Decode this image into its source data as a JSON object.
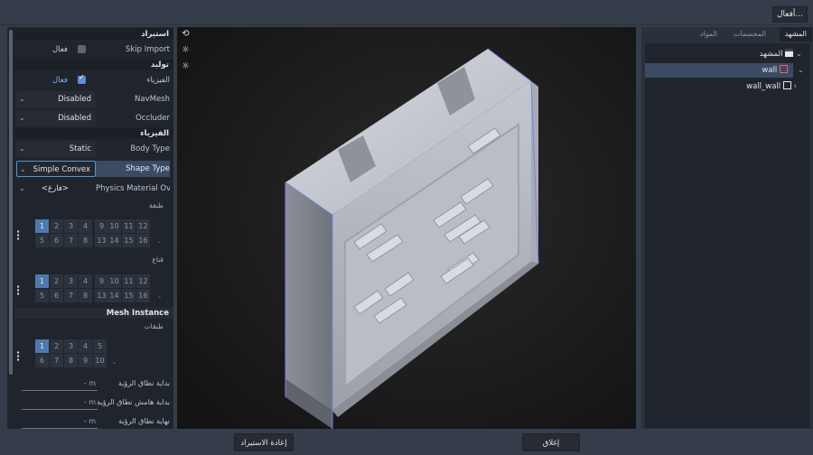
{
  "topbar": {
    "actions_label": "أفعال..."
  },
  "inspector": {
    "import_section": "استيراد",
    "skip_import": {
      "label": "Skip Import",
      "state": "فعال",
      "checked": false
    },
    "generate_section": "توليد",
    "physics_toggle": {
      "label": "الفيزياء",
      "state": "فعال",
      "checked": true
    },
    "navmesh": {
      "label": "NavMesh",
      "value": "Disabled"
    },
    "occluder": {
      "label": "Occluder",
      "value": "Disabled"
    },
    "physics_section": "الفيزياء",
    "body_type": {
      "label": "Body Type",
      "value": "Static"
    },
    "shape_type": {
      "label": "Shape Type",
      "value": "Simple Convex"
    },
    "physics_material": {
      "label": "Physics Material Ov",
      "value": "<فارغ>"
    },
    "layer_label": "طبقة",
    "mask_label": "قناع",
    "layer_cells": [
      "1",
      "2",
      "3",
      "4",
      "9",
      "10",
      "11",
      "12",
      "5",
      "6",
      "7",
      "8",
      "13",
      "14",
      "15",
      "16"
    ],
    "layer_selected": [
      "1"
    ],
    "mask_cells": [
      "1",
      "2",
      "3",
      "4",
      "9",
      "10",
      "11",
      "12",
      "5",
      "6",
      "7",
      "8",
      "13",
      "14",
      "15",
      "16"
    ],
    "mask_selected": [
      "1"
    ],
    "mesh_instance_section": "Mesh Instance",
    "mesh_layers_label": "طبقات",
    "mesh_layer_cells": [
      "1",
      "2",
      "3",
      "4",
      "5",
      "6",
      "7",
      "8",
      "9",
      "10"
    ],
    "mesh_layer_selected": [
      "1"
    ],
    "visibility_begin": {
      "label": "بداية نطاق الرؤية",
      "unit": "m"
    },
    "visibility_begin_margin": {
      "label": "بداية هامش نطاق الرؤية",
      "unit": "m"
    },
    "visibility_end": {
      "label": "نهاية نطاق الرؤية",
      "unit": "m"
    }
  },
  "scene_panel": {
    "tabs": [
      "المشهد",
      "المجسمات",
      "المواد"
    ],
    "active_tab": "المشهد",
    "nodes": [
      {
        "label": "المشهد",
        "icon": "clapperboard-icon"
      },
      {
        "label": "wall",
        "icon": "mesh-disabled-icon",
        "selected": true
      },
      {
        "label": "wall_wall",
        "icon": "mesh-icon"
      }
    ]
  },
  "bottom": {
    "reimport_label": "إعادة الاستيراد",
    "close_label": "إغلاق"
  },
  "colors": {
    "accent": "#5f8fd4",
    "panel": "#20252d",
    "selected_row": "#3c4a63",
    "viewport_bg": "#1b1b1c"
  }
}
